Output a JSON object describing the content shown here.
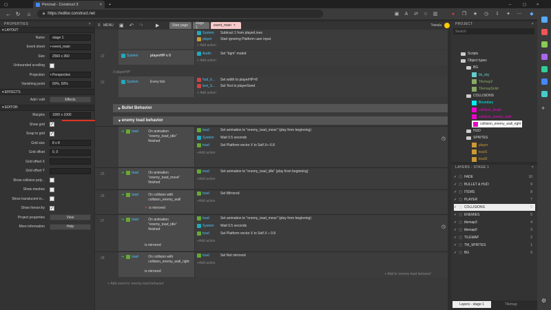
{
  "browser": {
    "tabs": [
      {
        "label": "Percival - Construct 3",
        "active": true
      }
    ],
    "url": "https://editor.construct.net"
  },
  "toolbar": {
    "menu_label": "MENU",
    "user": "Twesla",
    "tabs": [
      {
        "label": "Start page"
      },
      {
        "label": "stage 1"
      },
      {
        "label": "event_main",
        "active": true
      }
    ]
  },
  "properties": {
    "title": "PROPERTIES",
    "layout_section": "LAYOUT",
    "effects_section": "EFFECTS",
    "editor_section": "EDITOR",
    "rows": [
      {
        "label": "Name",
        "value": "stage 1"
      },
      {
        "label": "Event sheet",
        "value": "event_main"
      },
      {
        "label": "Size",
        "value": "2560 x 360"
      },
      {
        "label": "Unbounded scrolling",
        "value": ""
      },
      {
        "label": "Projection",
        "value": "Perspective"
      },
      {
        "label": "Vanishing point",
        "value": "50%, 50%"
      }
    ],
    "effects": {
      "label": "Add / edit",
      "button": "Effects"
    },
    "editor_rows": [
      {
        "label": "Margins",
        "value": "1000 x 1000",
        "kind": "text"
      },
      {
        "label": "Show grid",
        "kind": "check",
        "checked": true
      },
      {
        "label": "Snap to grid",
        "kind": "check",
        "checked": true
      },
      {
        "label": "Grid size",
        "value": "8 x 8",
        "kind": "text"
      },
      {
        "label": "Grid offset",
        "value": "0, 0",
        "kind": "text"
      },
      {
        "label": "Grid offset X",
        "value": "",
        "kind": "text"
      },
      {
        "label": "Grid offset Y",
        "value": "",
        "kind": "text"
      },
      {
        "label": "Show collision poly...",
        "kind": "check",
        "checked": false
      },
      {
        "label": "Show meshes",
        "kind": "check",
        "checked": false
      },
      {
        "label": "Show translucent in...",
        "kind": "check",
        "checked": false
      },
      {
        "label": "Show hierarchy",
        "kind": "check",
        "checked": true
      },
      {
        "label": "Project properties",
        "value": "View",
        "kind": "button"
      },
      {
        "label": "More information",
        "value": "Help",
        "kind": "button"
      }
    ]
  },
  "sheet": {
    "top_actions": [
      {
        "obj": "System",
        "text": "Subtract 1 from playerLives"
      },
      {
        "obj": "player",
        "text": "Start ignoring Platform user input"
      }
    ],
    "add_action": "Add action",
    "event22": {
      "num": "22",
      "obj": "System",
      "cond": "playerHP ≤ 0",
      "act_obj": "Audio",
      "act": "Set \"bgm\" muted"
    },
    "comment": "// playerHP",
    "event23": {
      "num": "23",
      "obj": "System",
      "cond": "Every tick",
      "acts": [
        {
          "obj": "hud_h...",
          "text": "Set width to playerHP×8"
        },
        {
          "obj": "text_S...",
          "text": "Set Text to playerSeed"
        }
      ]
    },
    "group1": "Bullet Behavior",
    "group2": "enemy toad behavior",
    "events": [
      {
        "num": "",
        "obj": "toad",
        "cond": "On animation \"enemy_toad_idle\" finished",
        "acts": [
          {
            "obj": "toad",
            "text": "Set animation to \"enemy_toad_move\" (play from beginning)"
          },
          {
            "obj": "System",
            "text": "Wait 0.5 seconds"
          },
          {
            "obj": "toad",
            "text": "Set Platform vector X to Self.X÷-0.8"
          }
        ]
      },
      {
        "num": "25",
        "obj": "toad",
        "cond": "On animation \"enemy_toad_move\" finished",
        "acts": [
          {
            "obj": "toad",
            "text": "Set animation to \"enemy_toad_idle\" (play from beginning)"
          }
        ]
      },
      {
        "num": "26",
        "obj": "toad",
        "cond": "On collision with collision_enemy_wall",
        "cond2": "is mirrored",
        "acts": [
          {
            "obj": "toad",
            "text": "Set Mirrored"
          }
        ]
      },
      {
        "num": "27",
        "obj": "toad",
        "cond": "On animation \"enemy_toad_idle\" finished",
        "cond2": "is mirrored",
        "acts": [
          {
            "obj": "toad",
            "text": "Set animation to \"enemy_toad_move\" (play from beginning)"
          },
          {
            "obj": "System",
            "text": "Wait 0.5 seconds"
          },
          {
            "obj": "toad",
            "text": "Set Platform vector X to Self.X ÷ 0.8"
          }
        ]
      },
      {
        "num": "28",
        "obj": "toad",
        "cond": "On collision with collision_enemy_wall_right",
        "cond2": "is mirrored",
        "acts": [
          {
            "obj": "toad",
            "text": "Set Not mirrored"
          }
        ]
      }
    ],
    "add_event": "Add event to 'enemy toad behavior'",
    "add_to": "Add to 'enemy toad behavior'"
  },
  "project": {
    "title": "PROJECT",
    "search_placeholder": "Search",
    "items": [
      {
        "label": "Scripts",
        "indent": 1,
        "kind": "folder"
      },
      {
        "label": "Object types",
        "indent": 1,
        "kind": "folder"
      },
      {
        "label": "BG",
        "indent": 2,
        "kind": "folder"
      },
      {
        "label": "bk_sky",
        "indent": 3,
        "kind": "obj",
        "color": "#6cc"
      },
      {
        "label": "Tilemap2",
        "indent": 3,
        "kind": "obj",
        "color": "#8a6"
      },
      {
        "label": "TilemapSolid",
        "indent": 3,
        "kind": "obj",
        "color": "#8a6"
      },
      {
        "label": "COLLISIONS",
        "indent": 2,
        "kind": "folder"
      },
      {
        "label": "Boundary",
        "indent": 3,
        "kind": "obj",
        "color": "#0ee"
      },
      {
        "label": "collision_death",
        "indent": 3,
        "kind": "obj",
        "color": "#e0c"
      },
      {
        "label": "collision_enemy_wall",
        "indent": 3,
        "kind": "obj",
        "color": "#e0c"
      },
      {
        "label": "collision_enemy_wall_right",
        "indent": 3,
        "kind": "obj",
        "color": "#e0c",
        "selected": true
      },
      {
        "label": "HUD",
        "indent": 2,
        "kind": "folder"
      },
      {
        "label": "SPRITES",
        "indent": 2,
        "kind": "folder"
      },
      {
        "label": "player",
        "indent": 3,
        "kind": "obj",
        "color": "#c93"
      },
      {
        "label": "toad1",
        "indent": 3,
        "kind": "obj",
        "color": "#c93"
      },
      {
        "label": "toad2",
        "indent": 3,
        "kind": "obj",
        "color": "#c93"
      }
    ]
  },
  "layers": {
    "title": "LAYERS - STAGE 1",
    "items": [
      {
        "label": "FADE",
        "count": "10"
      },
      {
        "label": "BULLET & HUD",
        "count": "9"
      },
      {
        "label": "ITEMS",
        "count": "8"
      },
      {
        "label": "PLAYER",
        "count": "7"
      },
      {
        "label": "COLLISIONS",
        "count": "6",
        "selected": true
      },
      {
        "label": "ENEMIES",
        "count": "5"
      },
      {
        "label": "tilemap3",
        "count": "4"
      },
      {
        "label": "tilemap0",
        "count": "3"
      },
      {
        "label": "TILEMAP",
        "count": "2"
      },
      {
        "label": "TM_SPRITES",
        "count": "1"
      },
      {
        "label": "BG",
        "count": "0"
      }
    ],
    "tab_layers": "Layers - stage 1",
    "tab_tilemap": "Tilemap"
  }
}
